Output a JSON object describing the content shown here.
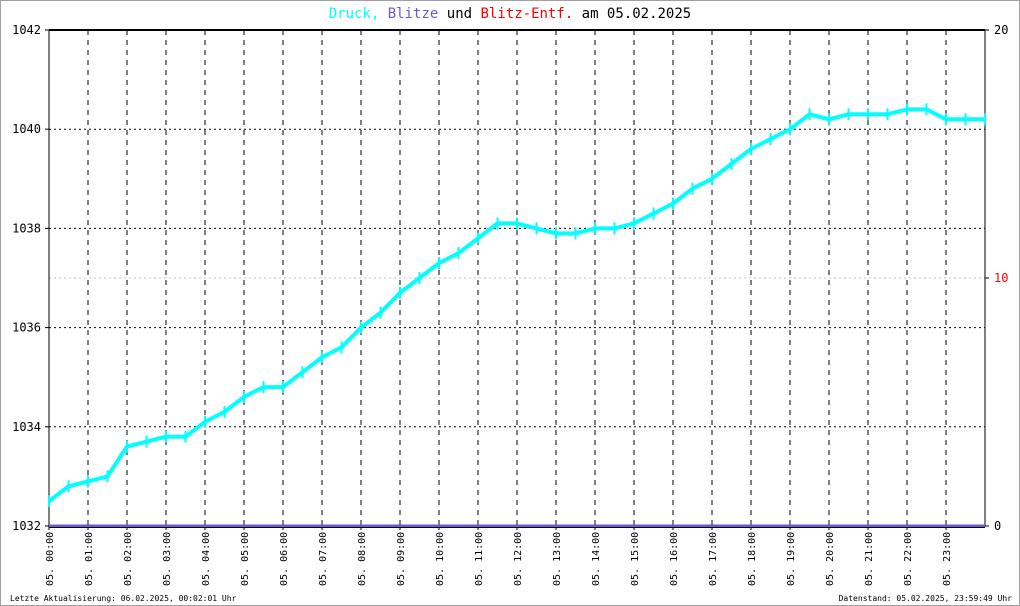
{
  "chart_data": {
    "type": "line",
    "title_parts": [
      {
        "text": "Druck,",
        "color": "#00ffff"
      },
      {
        "text": "Blitze",
        "color": "#6a5acd"
      },
      {
        "text": "und",
        "color": "#000000"
      },
      {
        "text": "Blitz-Entf.",
        "color": "#ff0000"
      },
      {
        "text": "am 05.02.2025",
        "color": "#000000"
      }
    ],
    "y_left": {
      "min": 1032,
      "max": 1042,
      "ticks": [
        "1032",
        "1034",
        "1036",
        "1038",
        "1040",
        "1042"
      ]
    },
    "y_right": {
      "min": 0,
      "max": 20,
      "ticks": [
        "0",
        "10",
        "20"
      ],
      "tick_colors": [
        "#000000",
        "#ff0000",
        "#000000"
      ]
    },
    "x_ticks": [
      "05. 00:00",
      "05. 01:00",
      "05. 02:00",
      "05. 03:00",
      "05. 04:00",
      "05. 05:00",
      "05. 06:00",
      "05. 07:00",
      "05. 08:00",
      "05. 09:00",
      "05. 10:00",
      "05. 11:00",
      "05. 12:00",
      "05. 13:00",
      "05. 14:00",
      "05. 15:00",
      "05. 16:00",
      "05. 17:00",
      "05. 18:00",
      "05. 19:00",
      "05. 20:00",
      "05. 21:00",
      "05. 22:00",
      "05. 23:00"
    ],
    "x_range_hours": [
      0,
      24
    ],
    "series": [
      {
        "name": "Druck",
        "color": "#00ffff",
        "axis": "left",
        "x": [
          0,
          0.5,
          1,
          1.5,
          2,
          2.5,
          3,
          3.5,
          4,
          4.5,
          5,
          5.5,
          6,
          6.5,
          7,
          7.5,
          8,
          8.5,
          9,
          9.5,
          10,
          10.5,
          11,
          11.5,
          12,
          12.5,
          13,
          13.5,
          14,
          14.5,
          15,
          15.5,
          16,
          16.5,
          17,
          17.5,
          18,
          18.5,
          19,
          19.5,
          20,
          20.5,
          21,
          21.5,
          22,
          22.5,
          23,
          23.5,
          24
        ],
        "values": [
          1032.5,
          1032.8,
          1032.9,
          1033.0,
          1033.6,
          1033.7,
          1033.8,
          1033.8,
          1034.1,
          1034.3,
          1034.6,
          1034.8,
          1034.8,
          1035.1,
          1035.4,
          1035.6,
          1036.0,
          1036.3,
          1036.7,
          1037.0,
          1037.3,
          1037.5,
          1037.8,
          1038.1,
          1038.1,
          1038.0,
          1037.9,
          1037.9,
          1038.0,
          1038.0,
          1038.1,
          1038.3,
          1038.5,
          1038.8,
          1039.0,
          1039.3,
          1039.6,
          1039.8,
          1040.0,
          1040.3,
          1040.2,
          1040.3,
          1040.3,
          1040.3,
          1040.4,
          1040.4,
          1040.2,
          1040.2,
          1040.2
        ]
      },
      {
        "name": "Blitze",
        "color": "#6a5acd",
        "axis": "right",
        "constant": 0
      }
    ],
    "grid": true
  },
  "footer": {
    "left": "Letzte Aktualisierung: 06.02.2025, 00:02:01 Uhr",
    "right": "Datenstand: 05.02.2025, 23:59:49 Uhr"
  }
}
